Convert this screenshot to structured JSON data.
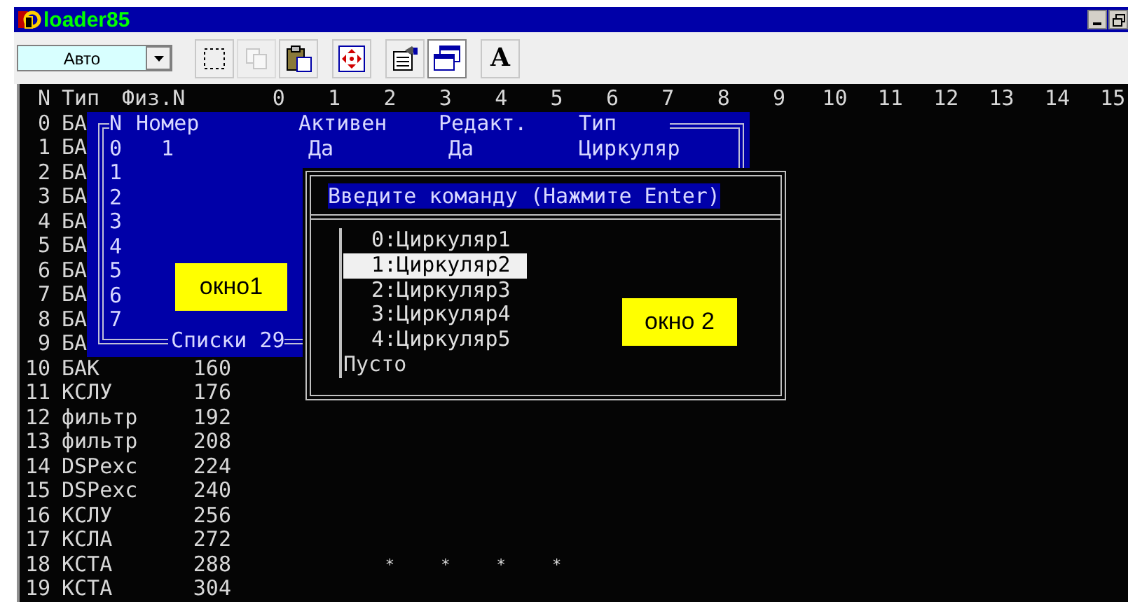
{
  "window": {
    "title": "loader85",
    "controls": [
      {
        "kind": "minimize"
      },
      {
        "kind": "restore"
      }
    ]
  },
  "toolbar": {
    "mode_select": {
      "value": "Авто"
    },
    "buttons": [
      {
        "kind": "select-rect",
        "disabled": false,
        "pressed": false
      },
      {
        "kind": "copy",
        "disabled": true,
        "pressed": false
      },
      {
        "kind": "paste",
        "disabled": false,
        "pressed": false
      },
      {
        "kind": "move",
        "disabled": false,
        "pressed": false
      },
      {
        "kind": "properties",
        "disabled": false,
        "pressed": false
      },
      {
        "kind": "window",
        "disabled": false,
        "pressed": true
      },
      {
        "kind": "text",
        "label": "A",
        "disabled": false,
        "pressed": false
      }
    ]
  },
  "grid": {
    "columns": [
      "N",
      "Тип",
      "Физ.N",
      "0",
      "1",
      "2",
      "3",
      "4",
      "5",
      "6",
      "7",
      "8",
      "9",
      "10",
      "11",
      "12",
      "13",
      "14",
      "15"
    ],
    "rows": [
      {
        "n": "0",
        "type": "БА"
      },
      {
        "n": "1",
        "type": "БА"
      },
      {
        "n": "2",
        "type": "БА"
      },
      {
        "n": "3",
        "type": "БА"
      },
      {
        "n": "4",
        "type": "БА"
      },
      {
        "n": "5",
        "type": "БА"
      },
      {
        "n": "6",
        "type": "БА"
      },
      {
        "n": "7",
        "type": "БА"
      },
      {
        "n": "8",
        "type": "БА"
      },
      {
        "n": "9",
        "type": "БА"
      },
      {
        "n": "10",
        "type": "БАК",
        "phys": "160"
      },
      {
        "n": "11",
        "type": "КСЛУ",
        "phys": "176"
      },
      {
        "n": "12",
        "type": "фильтр",
        "phys": "192"
      },
      {
        "n": "13",
        "type": "фильтр",
        "phys": "208"
      },
      {
        "n": "14",
        "type": "DSPexc",
        "phys": "224"
      },
      {
        "n": "15",
        "type": "DSPexc",
        "phys": "240"
      },
      {
        "n": "16",
        "type": "КСЛУ",
        "phys": "256"
      },
      {
        "n": "17",
        "type": "КСЛА",
        "phys": "272"
      },
      {
        "n": "18",
        "type": "КСТА",
        "phys": "288",
        "marks": [
          "*",
          "*",
          "*",
          "*"
        ]
      },
      {
        "n": "19",
        "type": "КСТА",
        "phys": "304"
      }
    ]
  },
  "window_1": {
    "columns": [
      "N",
      "Номер",
      "Активен",
      "Редакт.",
      "Тип"
    ],
    "rows": [
      {
        "n": "0",
        "number": "1",
        "active": "Да",
        "editable": "Да",
        "type": "Циркуляр"
      },
      {
        "n": "1"
      },
      {
        "n": "2"
      },
      {
        "n": "3"
      },
      {
        "n": "4"
      },
      {
        "n": "5"
      },
      {
        "n": "6"
      },
      {
        "n": "7"
      }
    ],
    "footer": "Списки 29",
    "annotation": "окно1"
  },
  "window_2": {
    "prompt": "Введите команду (Нажмите Enter)",
    "items": [
      {
        "label": "0:Циркуляр1",
        "selected": false
      },
      {
        "label": "1:Циркуляр2",
        "selected": true
      },
      {
        "label": "2:Циркуляр3",
        "selected": false
      },
      {
        "label": "3:Циркуляр4",
        "selected": false
      },
      {
        "label": "4:Циркуляр5",
        "selected": false
      }
    ],
    "empty_label": "Пусто",
    "annotation": "окно 2"
  }
}
